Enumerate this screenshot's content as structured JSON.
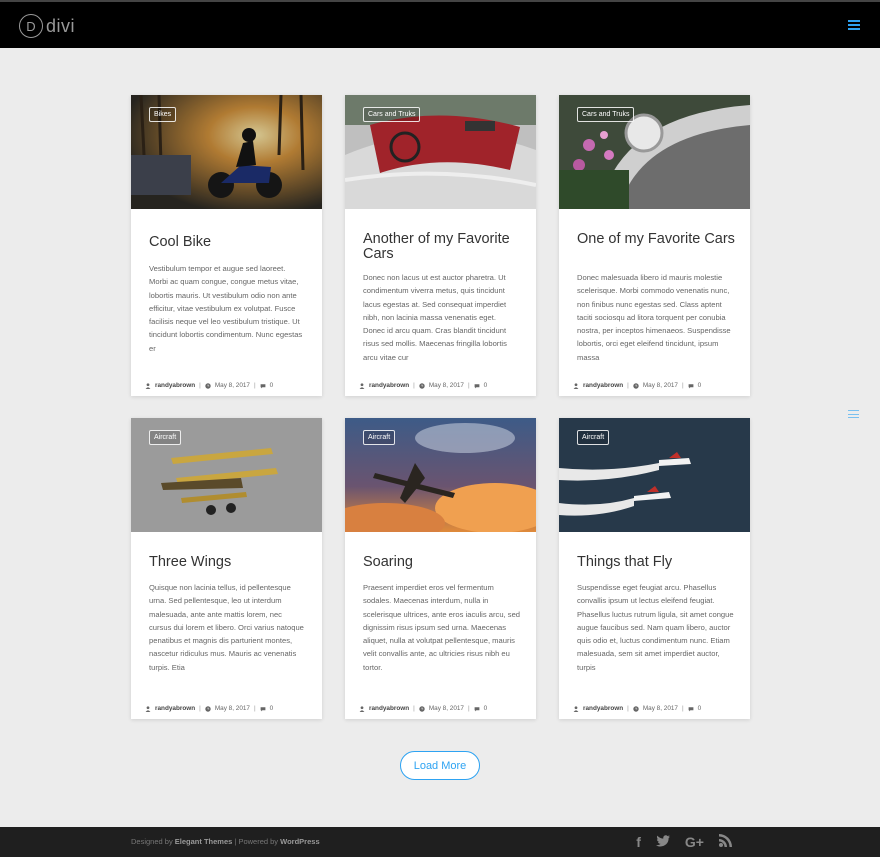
{
  "header": {
    "logo_letter": "D",
    "logo_text": "divi"
  },
  "posts": [
    {
      "category": "Bikes",
      "title": "Cool Bike",
      "excerpt": "Vestibulum tempor et augue sed laoreet. Morbi ac quam congue, congue metus vitae, lobortis mauris. Ut vestibulum odio non ante efficitur, vitae vestibulum ex volutpat. Fusce facilisis neque vel leo vestibulum tristique. Ut tincidunt lobortis condimentum. Nunc egestas er",
      "author": "randyabrown",
      "date": "May 8, 2017",
      "comments": "0"
    },
    {
      "category": "Cars and Truks",
      "title": "Another of my Favorite Cars",
      "excerpt": "Donec non lacus ut est auctor pharetra. Ut condimentum viverra metus, quis tincidunt lacus egestas at. Sed consequat imperdiet nibh, non lacinia massa venenatis eget. Donec id arcu quam. Cras blandit tincidunt risus sed mollis. Maecenas fringilla lobortis arcu vitae cur",
      "author": "randyabrown",
      "date": "May 8, 2017",
      "comments": "0"
    },
    {
      "category": "Cars and Truks",
      "title": "One of my Favorite Cars",
      "excerpt": "Donec malesuada libero id mauris molestie scelerisque. Morbi commodo venenatis nunc, non finibus nunc egestas sed. Class aptent taciti sociosqu ad litora torquent per conubia nostra, per inceptos himenaeos. Suspendisse lobortis, orci eget eleifend tincidunt, ipsum massa",
      "author": "randyabrown",
      "date": "May 8, 2017",
      "comments": "0"
    },
    {
      "category": "Aircraft",
      "title": "Three Wings",
      "excerpt": "Quisque non lacinia tellus, id pellentesque urna. Sed pellentesque, leo ut interdum malesuada, ante ante mattis lorem, nec cursus dui lorem et libero. Orci varius natoque penatibus et magnis dis parturient montes, nascetur ridiculus mus. Mauris ac venenatis turpis. Etia",
      "author": "randyabrown",
      "date": "May 8, 2017",
      "comments": "0"
    },
    {
      "category": "Aircraft",
      "title": "Soaring",
      "excerpt": "Praesent imperdiet eros vel fermentum sodales. Maecenas interdum, nulla in scelerisque ultrices, ante eros iaculis arcu, sed dignissim risus ipsum sed urna. Maecenas aliquet, nulla at volutpat pellentesque, mauris velit convallis ante, ac ultricies risus nibh eu tortor.",
      "author": "randyabrown",
      "date": "May 8, 2017",
      "comments": "0"
    },
    {
      "category": "Aircraft",
      "title": "Things that Fly",
      "excerpt": "Suspendisse eget feugiat arcu. Phasellus convallis ipsum ut lectus eleifend feugiat. Phasellus luctus rutrum ligula, sit amet congue augue faucibus sed. Nam quam libero, auctor quis odio et, luctus condimentum nunc. Etiam malesuada, sem sit amet imperdiet auctor, turpis",
      "author": "randyabrown",
      "date": "May 8, 2017",
      "comments": "0"
    }
  ],
  "meta_separator": "|",
  "load_more_label": "Load More",
  "footer": {
    "designed_by": "Designed by",
    "elegant_themes": "Elegant Themes",
    "powered_by": "| Powered by",
    "wordpress": "WordPress",
    "social": [
      {
        "icon": "facebook-icon",
        "glyph": "f"
      },
      {
        "icon": "twitter-icon",
        "glyph": "🐦"
      },
      {
        "icon": "google-plus-icon",
        "glyph": "G+"
      },
      {
        "icon": "rss-icon",
        "glyph": "☰"
      }
    ]
  }
}
